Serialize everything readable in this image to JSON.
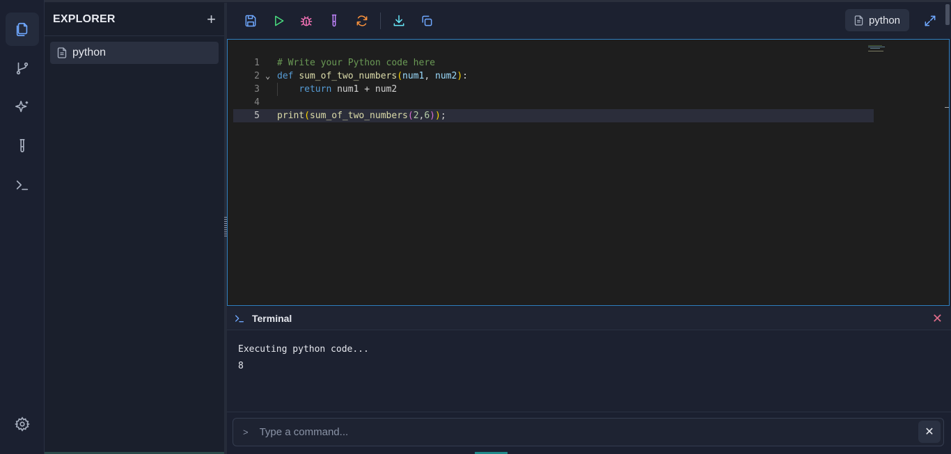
{
  "explorer": {
    "title": "EXPLORER",
    "add_icon": "plus-icon",
    "files": [
      {
        "name": "python",
        "icon": "file-icon"
      }
    ]
  },
  "activity_bar": {
    "items": [
      "files-icon",
      "git-branch-icon",
      "sparkles-icon",
      "test-tube-icon",
      "terminal-icon"
    ],
    "bottom": "gear-icon"
  },
  "toolbar": {
    "buttons": [
      "save-icon",
      "run-icon",
      "debug-icon",
      "test-icon",
      "refresh-icon",
      "download-icon",
      "copy-icon"
    ],
    "language": "python"
  },
  "editor": {
    "lines": [
      {
        "n": "1",
        "text": "# Write your Python code here"
      },
      {
        "n": "2",
        "text": "def sum_of_two_numbers(num1, num2):"
      },
      {
        "n": "3",
        "text": "    return num1 + num2"
      },
      {
        "n": "4",
        "text": ""
      },
      {
        "n": "5",
        "text": "print(sum_of_two_numbers(2,6));"
      }
    ],
    "current_line": 5
  },
  "terminal": {
    "title": "Terminal",
    "output": [
      "Executing python code...",
      "8"
    ]
  },
  "command": {
    "prompt": ">",
    "placeholder": "Type a command..."
  },
  "colors": {
    "accent": "#2f7fc0",
    "close": "#e06c8a"
  }
}
